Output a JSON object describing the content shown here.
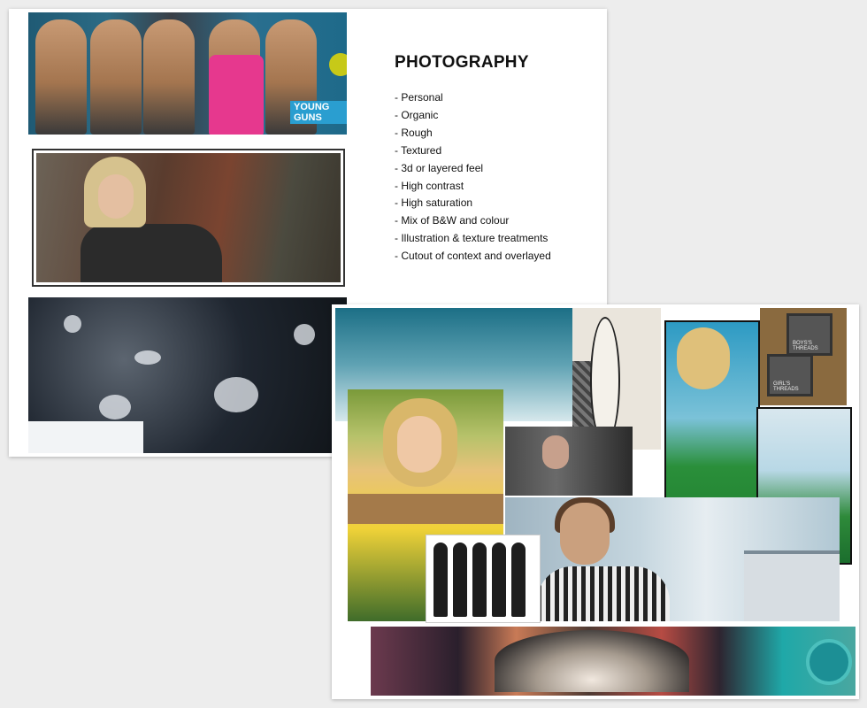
{
  "slide1": {
    "title": "PHOTOGRAPHY",
    "items": [
      "- Personal",
      "- Organic",
      "- Rough",
      "- Textured",
      "- 3d or layered feel",
      "- High contrast",
      "- High saturation",
      "- Mix of B&W and colour",
      "- Illustration & texture treatments",
      "- Cutout of context and overlayed"
    ],
    "band_text": "YOUNG GUNS"
  },
  "slide2": {
    "polaroid_labels": [
      "BOYS'S THREADS",
      "GIRL'S THREADS"
    ]
  },
  "colors": {
    "background": "#ededed",
    "page": "#ffffff",
    "text": "#111111"
  }
}
